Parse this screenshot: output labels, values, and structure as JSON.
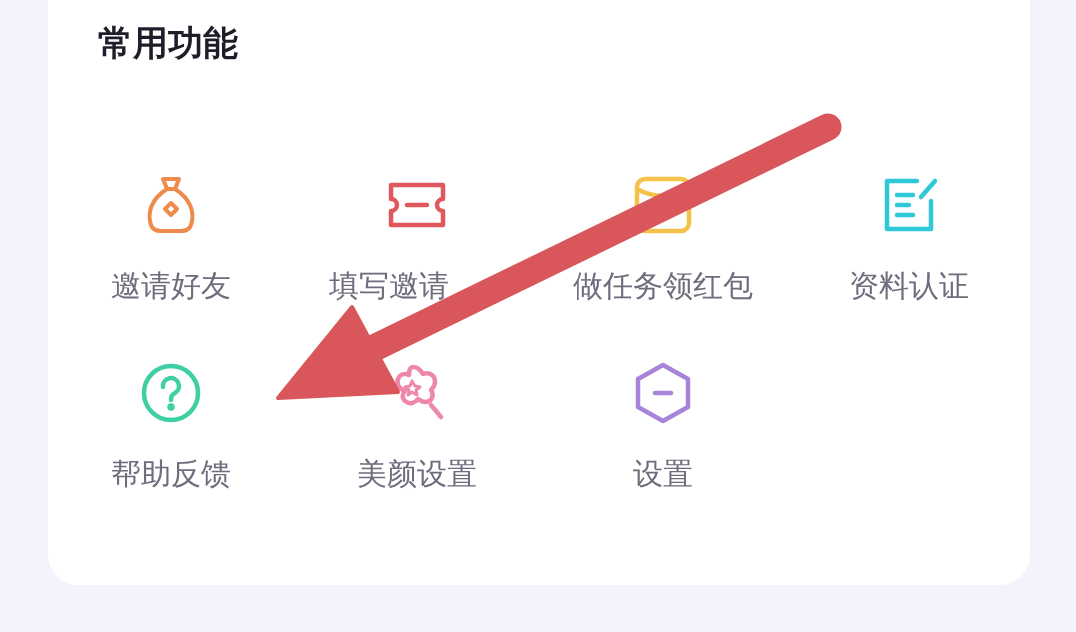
{
  "section": {
    "title": "常用功能"
  },
  "items": [
    {
      "label": "邀请好友",
      "color": "#ef8a4d"
    },
    {
      "label": "填写邀请",
      "color": "#e0575d"
    },
    {
      "label": "做任务领红包",
      "color": "#f4c14a"
    },
    {
      "label": "资料认证",
      "color": "#2ec8d8"
    },
    {
      "label": "帮助反馈",
      "color": "#3fcfa4"
    },
    {
      "label": "美颜设置",
      "color": "#ee88aa"
    },
    {
      "label": "设置",
      "color": "#a884d8"
    }
  ]
}
